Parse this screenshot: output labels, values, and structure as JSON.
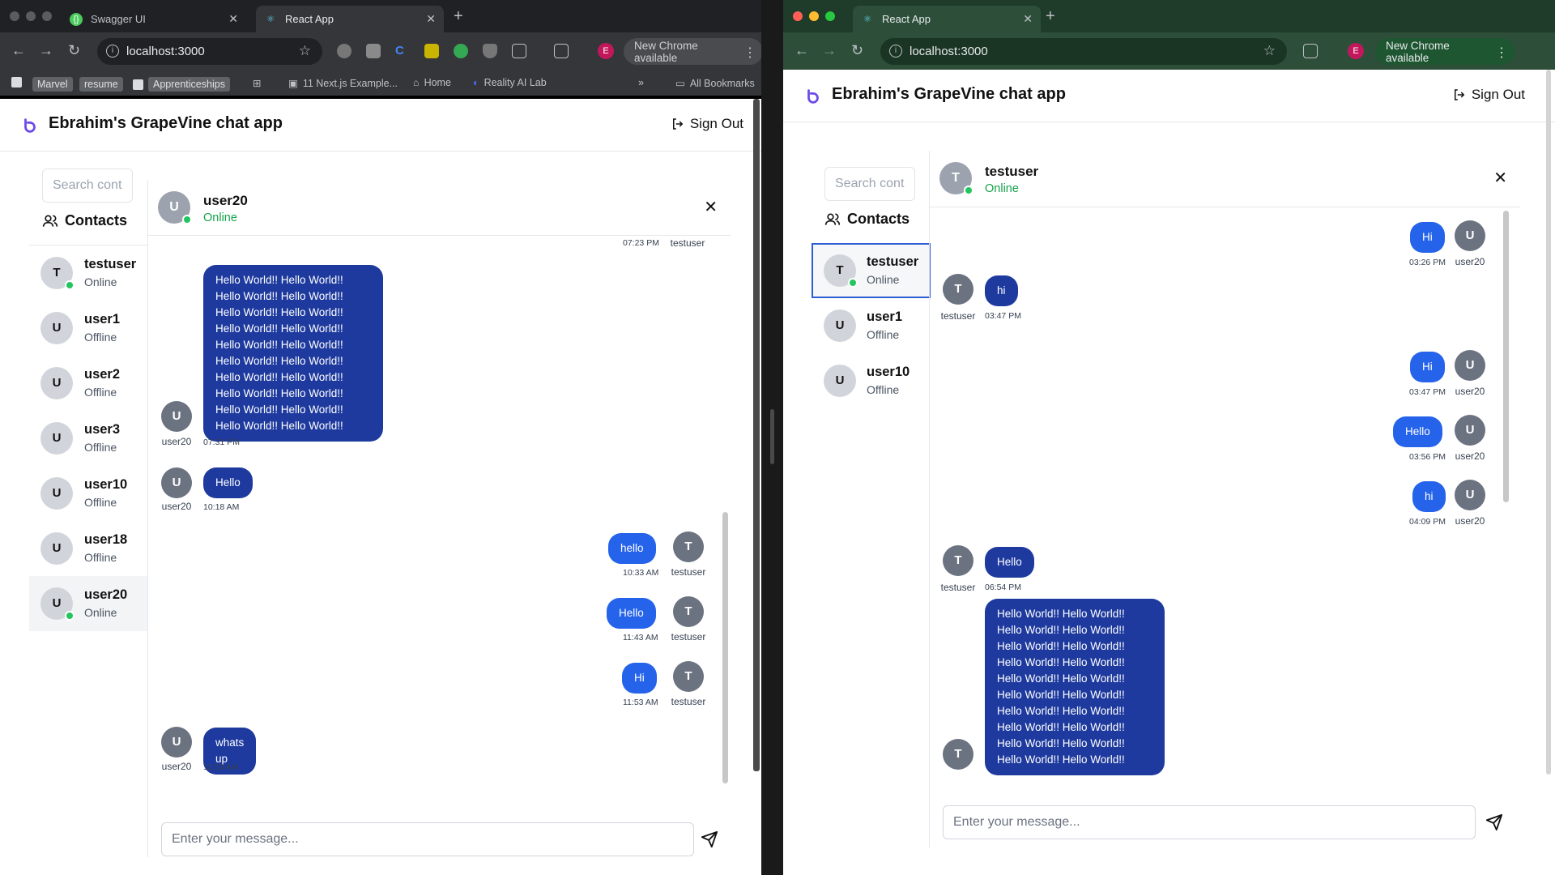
{
  "left": {
    "tabs": [
      {
        "title": "Swagger UI",
        "active": false
      },
      {
        "title": "React App",
        "active": true
      }
    ],
    "url": "localhost:3000",
    "new_chrome": "New Chrome available",
    "profile_initial": "E",
    "bookmarks": [
      "Marvel",
      "resume",
      "Apprenticeships",
      "11 Next.js Example...",
      "Home",
      "Reality AI Lab",
      "»",
      "All Bookmarks"
    ],
    "app_title": "Ebrahim's GrapeVine chat app",
    "sign_out": "Sign Out",
    "search_placeholder": "Search cont",
    "contacts_title": "Contacts",
    "contacts": [
      {
        "initial": "T",
        "name": "testuser",
        "status": "Online",
        "online": true
      },
      {
        "initial": "U",
        "name": "user1",
        "status": "Offline",
        "online": false
      },
      {
        "initial": "U",
        "name": "user2",
        "status": "Offline",
        "online": false
      },
      {
        "initial": "U",
        "name": "user3",
        "status": "Offline",
        "online": false
      },
      {
        "initial": "U",
        "name": "user10",
        "status": "Offline",
        "online": false
      },
      {
        "initial": "U",
        "name": "user18",
        "status": "Offline",
        "online": false
      },
      {
        "initial": "U",
        "name": "user20",
        "status": "Online",
        "online": true
      }
    ],
    "chat_header": {
      "initial": "U",
      "name": "user20",
      "status": "Online"
    },
    "messages": [
      {
        "time": "07:23 PM",
        "user": "testuser"
      },
      {
        "initial": "U",
        "user": "user20",
        "text": "Hello World!! Hello World!!\nHello World!! Hello World!!\nHello World!! Hello World!!\nHello World!! Hello World!!\nHello World!! Hello World!!\nHello World!! Hello World!!\nHello World!! Hello World!!\nHello World!! Hello World!!\nHello World!! Hello World!!\nHello World!! Hello World!!",
        "time": "07:31 PM"
      },
      {
        "initial": "U",
        "user": "user20",
        "text": "Hello",
        "time": "10:18 AM"
      },
      {
        "initial": "T",
        "user": "testuser",
        "text": "hello",
        "time": "10:33 AM"
      },
      {
        "initial": "T",
        "user": "testuser",
        "text": "Hello",
        "time": "11:43 AM"
      },
      {
        "initial": "T",
        "user": "testuser",
        "text": "Hi",
        "time": "11:53 AM"
      },
      {
        "initial": "U",
        "user": "user20",
        "text": "whats up",
        "time": "11:53 AM"
      }
    ],
    "composer_placeholder": "Enter your message..."
  },
  "right": {
    "tabs": [
      {
        "title": "React App",
        "active": true
      }
    ],
    "url": "localhost:3000",
    "new_chrome": "New Chrome available",
    "profile_initial": "E",
    "app_title": "Ebrahim's GrapeVine chat app",
    "sign_out": "Sign Out",
    "search_placeholder": "Search cont",
    "contacts_title": "Contacts",
    "contacts": [
      {
        "initial": "T",
        "name": "testuser",
        "status": "Online",
        "online": true
      },
      {
        "initial": "U",
        "name": "user1",
        "status": "Offline",
        "online": false
      },
      {
        "initial": "U",
        "name": "user10",
        "status": "Offline",
        "online": false
      }
    ],
    "chat_header": {
      "initial": "T",
      "name": "testuser",
      "status": "Online"
    },
    "messages": [
      {
        "initial": "U",
        "user": "user20",
        "text": "Hi",
        "time": "03:26 PM"
      },
      {
        "initial": "T",
        "user": "testuser",
        "text": "hi",
        "time": "03:47 PM"
      },
      {
        "initial": "U",
        "user": "user20",
        "text": "Hi",
        "time": "03:47 PM"
      },
      {
        "initial": "U",
        "user": "user20",
        "text": "Hello",
        "time": "03:56 PM"
      },
      {
        "initial": "U",
        "user": "user20",
        "text": "hi",
        "time": "04:09 PM"
      },
      {
        "initial": "T",
        "user": "testuser",
        "text": "Hello",
        "time": "06:54 PM"
      },
      {
        "initial": "T",
        "user": "testuser",
        "text": "Hello World!! Hello World!!\nHello World!! Hello World!!\nHello World!! Hello World!!\nHello World!! Hello World!!\nHello World!! Hello World!!\nHello World!! Hello World!!\nHello World!! Hello World!!\nHello World!! Hello World!!\nHello World!! Hello World!!\nHello World!! Hello World!!"
      }
    ],
    "composer_placeholder": "Enter your message..."
  },
  "colors": {
    "incoming_bubble": "#1e3a9e",
    "outgoing_bubble": "#2563eb",
    "online": "#16a34a",
    "logo": "#6d4ae8",
    "left_chrome": "#35363a",
    "right_chrome": "#2d4f39"
  }
}
